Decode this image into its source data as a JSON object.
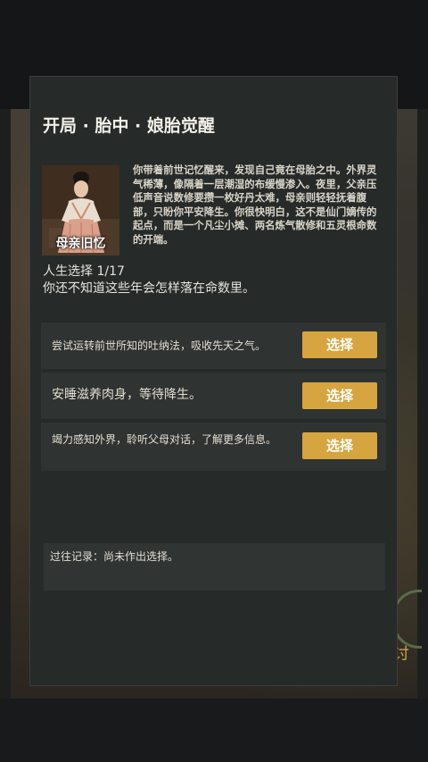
{
  "header": {
    "title": "开局 · 胎中 · 娘胎觉醒"
  },
  "portrait": {
    "label": "母亲旧忆"
  },
  "story": {
    "text": "你带着前世记忆醒来，发现自己竟在母胎之中。外界灵气稀薄，像隔着一层潮湿的布缓慢渗入。夜里，父亲压低声音说数修要攒一枚好丹太难，母亲则轻轻抚着腹部，只盼你平安降生。你很快明白，这不是仙门嫡传的起点，而是一个凡尘小摊、两名炼气散修和五灵根命数的开端。"
  },
  "progress": {
    "label": "人生选择 1/17",
    "description": "你还不知道这些年会怎样落在命数里。"
  },
  "options": [
    {
      "text": "尝试运转前世所知的吐纳法，吸收先天之气。",
      "button": "选择"
    },
    {
      "text": "安睡滋养肉身，等待降生。",
      "button": "选择"
    },
    {
      "text": "竭力感知外界，聆听父母对话，了解更多信息。",
      "button": "选择"
    }
  ],
  "history": {
    "text": "过往记录：尚未作出选择。"
  },
  "decor": {
    "side_glyph": "讨"
  },
  "colors": {
    "accent": "#d7a53f",
    "panel": "#262a29",
    "option_bg": "#2f3331"
  }
}
